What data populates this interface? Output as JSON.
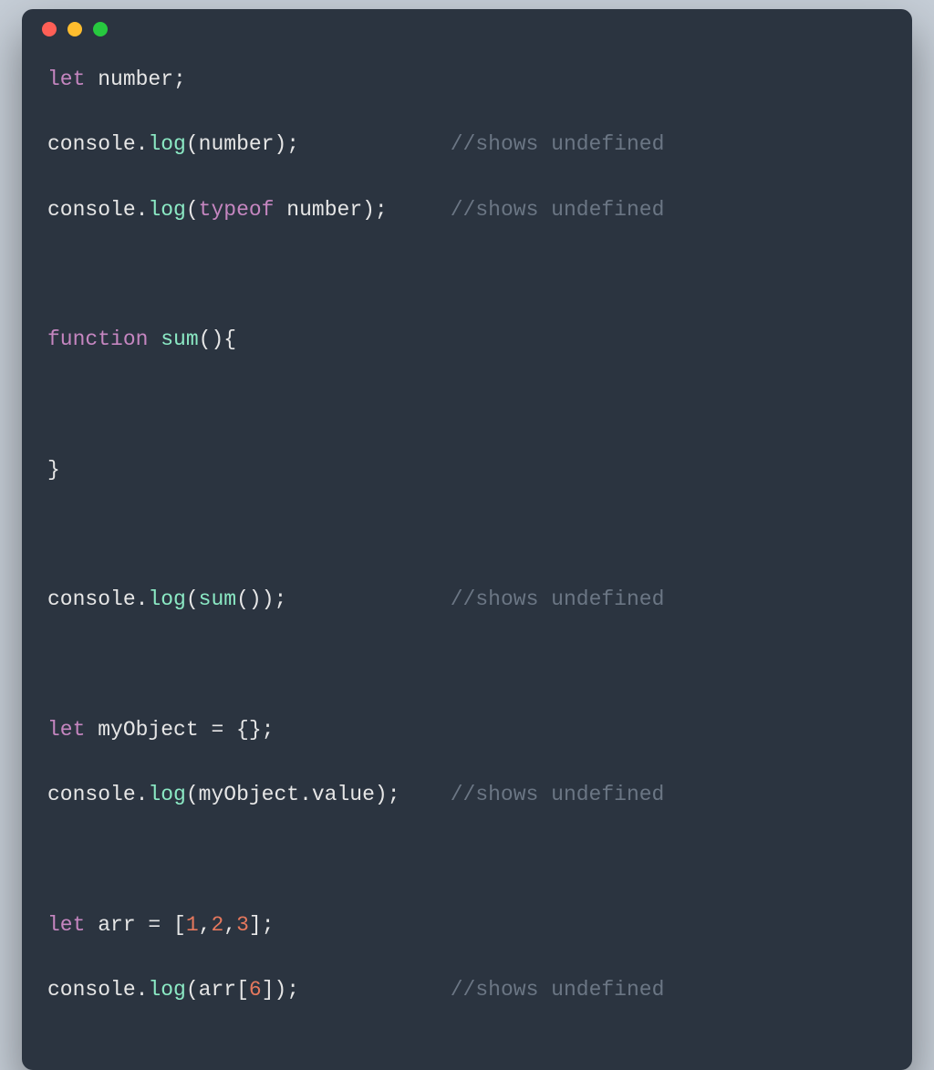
{
  "colors": {
    "window_bg": "#2b3440",
    "dot_red": "#ff5f56",
    "dot_yellow": "#ffbd2e",
    "dot_green": "#27c93f",
    "keyword": "#c586c0",
    "func": "#8be9c4",
    "number": "#e5785d",
    "comment": "#6b7684",
    "text": "#e6e6e6"
  },
  "code": {
    "lines": [
      {
        "tokens": [
          {
            "t": "let ",
            "c": "c-keyword"
          },
          {
            "t": "number;",
            "c": "c-var"
          }
        ]
      },
      {
        "tokens": [
          {
            "t": "console",
            "c": "c-var"
          },
          {
            "t": ".",
            "c": "c-punct"
          },
          {
            "t": "log",
            "c": "c-func"
          },
          {
            "t": "(number);",
            "c": "c-var"
          }
        ],
        "comment": "//shows undefined"
      },
      {
        "tokens": [
          {
            "t": "console",
            "c": "c-var"
          },
          {
            "t": ".",
            "c": "c-punct"
          },
          {
            "t": "log",
            "c": "c-func"
          },
          {
            "t": "(",
            "c": "c-punct"
          },
          {
            "t": "typeof",
            "c": "c-keyword"
          },
          {
            "t": " number);",
            "c": "c-var"
          }
        ],
        "comment": "//shows undefined"
      },
      {
        "tokens": [
          {
            "t": " ",
            "c": "c-var"
          }
        ]
      },
      {
        "tokens": [
          {
            "t": "function ",
            "c": "c-keyword"
          },
          {
            "t": "sum",
            "c": "c-funcname"
          },
          {
            "t": "(){",
            "c": "c-punct"
          }
        ]
      },
      {
        "tokens": [
          {
            "t": " ",
            "c": "c-var"
          }
        ]
      },
      {
        "tokens": [
          {
            "t": "}",
            "c": "c-punct"
          }
        ]
      },
      {
        "tokens": [
          {
            "t": " ",
            "c": "c-var"
          }
        ]
      },
      {
        "tokens": [
          {
            "t": "console",
            "c": "c-var"
          },
          {
            "t": ".",
            "c": "c-punct"
          },
          {
            "t": "log",
            "c": "c-func"
          },
          {
            "t": "(",
            "c": "c-punct"
          },
          {
            "t": "sum",
            "c": "c-funcname"
          },
          {
            "t": "());",
            "c": "c-punct"
          }
        ],
        "comment": "//shows undefined"
      },
      {
        "tokens": [
          {
            "t": " ",
            "c": "c-var"
          }
        ]
      },
      {
        "tokens": [
          {
            "t": "let ",
            "c": "c-keyword"
          },
          {
            "t": "myObject = {};",
            "c": "c-var"
          }
        ]
      },
      {
        "tokens": [
          {
            "t": "console",
            "c": "c-var"
          },
          {
            "t": ".",
            "c": "c-punct"
          },
          {
            "t": "log",
            "c": "c-func"
          },
          {
            "t": "(myObject.value);",
            "c": "c-var"
          }
        ],
        "comment": "//shows undefined"
      },
      {
        "tokens": [
          {
            "t": " ",
            "c": "c-var"
          }
        ]
      },
      {
        "tokens": [
          {
            "t": "let ",
            "c": "c-keyword"
          },
          {
            "t": "arr = [",
            "c": "c-var"
          },
          {
            "t": "1",
            "c": "c-number"
          },
          {
            "t": ",",
            "c": "c-var"
          },
          {
            "t": "2",
            "c": "c-number"
          },
          {
            "t": ",",
            "c": "c-var"
          },
          {
            "t": "3",
            "c": "c-number"
          },
          {
            "t": "];",
            "c": "c-var"
          }
        ]
      },
      {
        "tokens": [
          {
            "t": "console",
            "c": "c-var"
          },
          {
            "t": ".",
            "c": "c-punct"
          },
          {
            "t": "log",
            "c": "c-func"
          },
          {
            "t": "(arr[",
            "c": "c-var"
          },
          {
            "t": "6",
            "c": "c-number"
          },
          {
            "t": "]);",
            "c": "c-var"
          }
        ],
        "comment": "//shows undefined"
      }
    ]
  }
}
